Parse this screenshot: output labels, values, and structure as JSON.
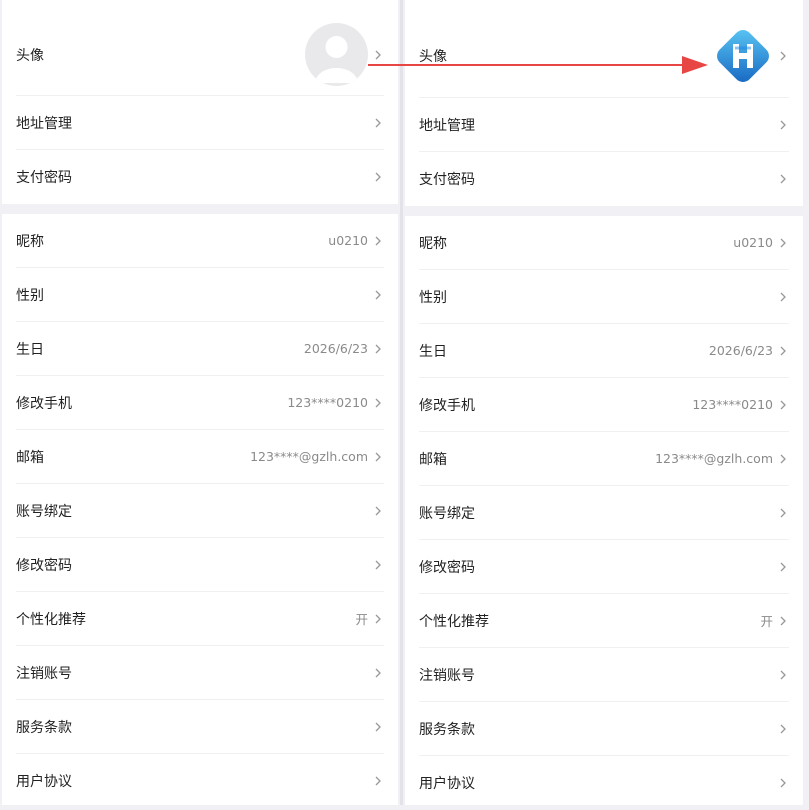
{
  "left": {
    "card1": [
      {
        "label": "头像",
        "value": ""
      },
      {
        "label": "地址管理",
        "value": ""
      },
      {
        "label": "支付密码",
        "value": ""
      }
    ],
    "card2": [
      {
        "label": "昵称",
        "value": "u0210"
      },
      {
        "label": "性别",
        "value": ""
      },
      {
        "label": "生日",
        "value": "2026/6/23"
      },
      {
        "label": "修改手机",
        "value": "123****0210"
      },
      {
        "label": "邮箱",
        "value": "123****@gzlh.com"
      },
      {
        "label": "账号绑定",
        "value": ""
      },
      {
        "label": "修改密码",
        "value": ""
      },
      {
        "label": "个性化推荐",
        "value": "开"
      },
      {
        "label": "注销账号",
        "value": ""
      },
      {
        "label": "服务条款",
        "value": ""
      },
      {
        "label": "用户协议",
        "value": ""
      }
    ]
  },
  "right": {
    "card1": [
      {
        "label": "头像",
        "value": ""
      },
      {
        "label": "地址管理",
        "value": ""
      },
      {
        "label": "支付密码",
        "value": ""
      }
    ],
    "card2": [
      {
        "label": "昵称",
        "value": "u0210"
      },
      {
        "label": "性别",
        "value": ""
      },
      {
        "label": "生日",
        "value": "2026/6/23"
      },
      {
        "label": "修改手机",
        "value": "123****0210"
      },
      {
        "label": "邮箱",
        "value": "123****@gzlh.com"
      },
      {
        "label": "账号绑定",
        "value": ""
      },
      {
        "label": "修改密码",
        "value": ""
      },
      {
        "label": "个性化推荐",
        "value": "开"
      },
      {
        "label": "注销账号",
        "value": ""
      },
      {
        "label": "服务条款",
        "value": ""
      },
      {
        "label": "用户协议",
        "value": ""
      }
    ]
  },
  "icons": {
    "chevron": "chevron-right-icon",
    "avatar_default": "default-avatar-icon",
    "avatar_logo": "app-logo-icon",
    "arrow": "annotation-arrow"
  },
  "colors": {
    "arrow": "#e84545",
    "logo_light": "#3fb3ee",
    "logo_dark": "#1565c0"
  }
}
